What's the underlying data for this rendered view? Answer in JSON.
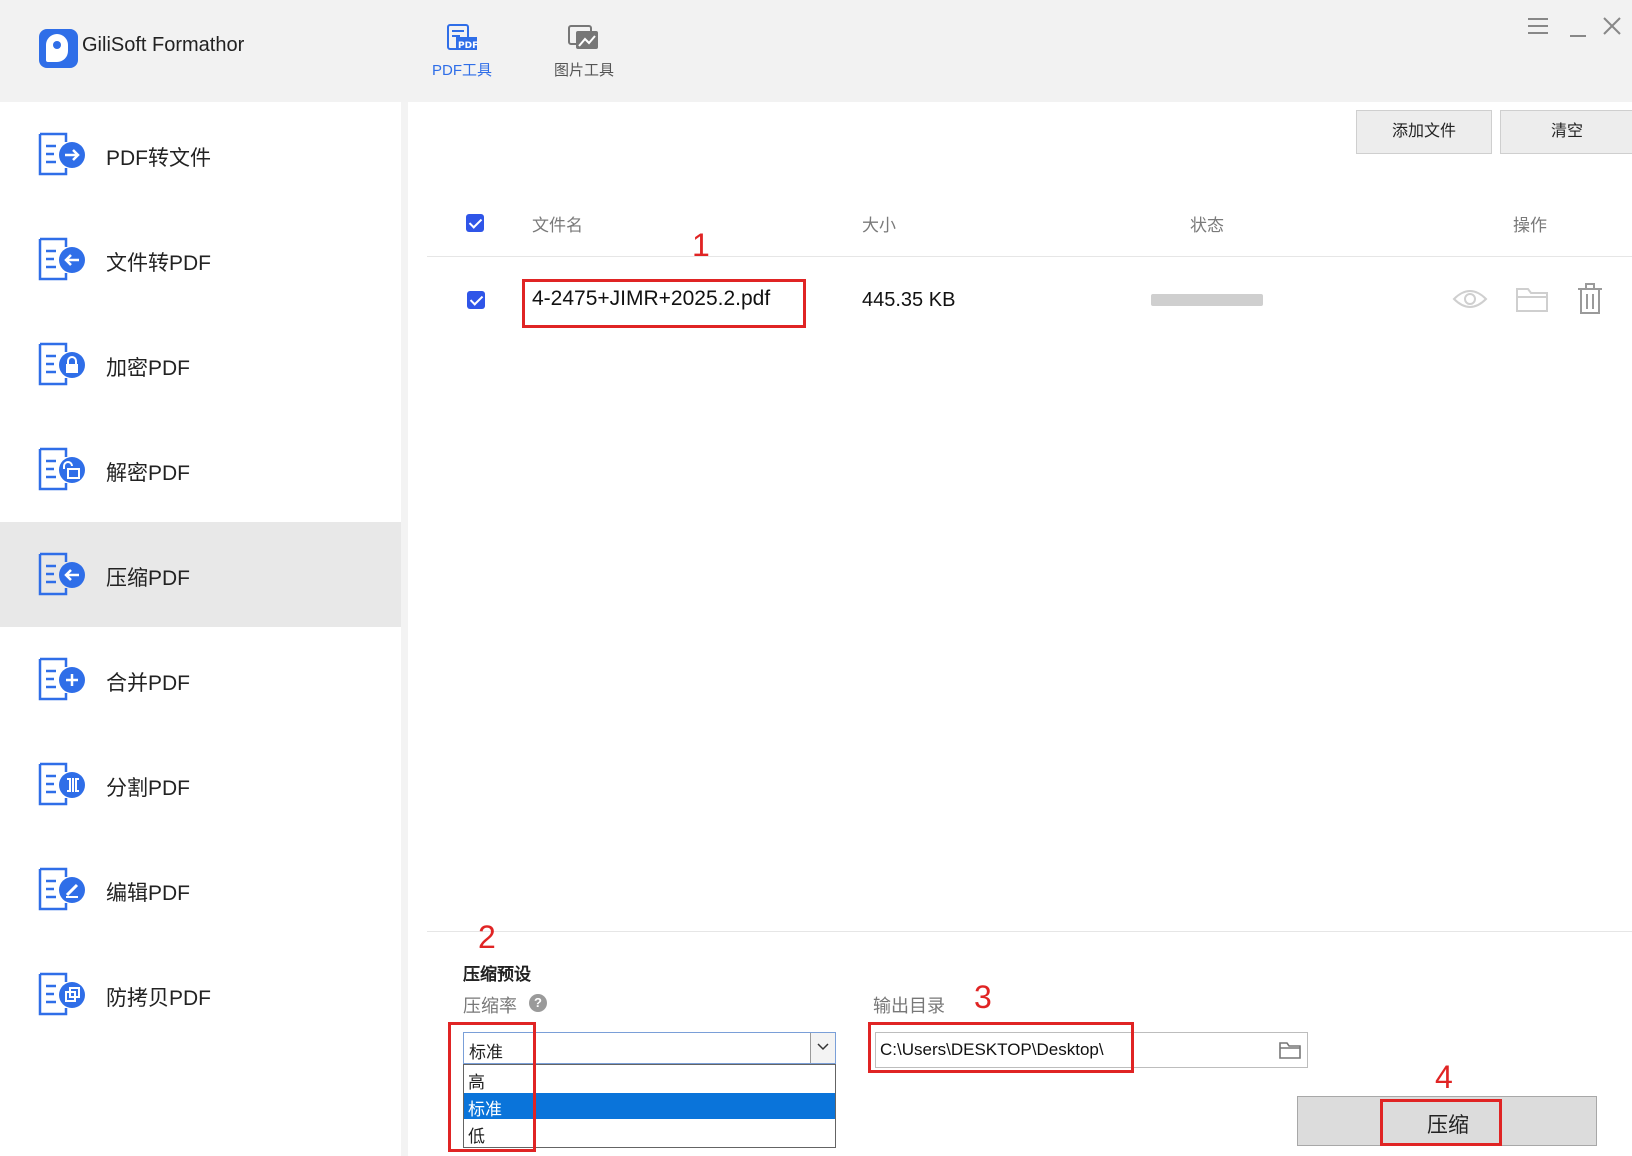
{
  "app": {
    "title": "GiliSoft Formathor"
  },
  "top_tabs": [
    {
      "label": "PDF工具",
      "active": true,
      "icon": "pdf-tool-icon"
    },
    {
      "label": "图片工具",
      "active": false,
      "icon": "image-tool-icon"
    }
  ],
  "window_controls": [
    "menu-icon",
    "minimize-icon",
    "close-icon"
  ],
  "sidebar": {
    "items": [
      {
        "label": "PDF转文件",
        "icon": "pdf-to-file-icon",
        "active": false
      },
      {
        "label": "文件转PDF",
        "icon": "file-to-pdf-icon",
        "active": false
      },
      {
        "label": "加密PDF",
        "icon": "encrypt-pdf-icon",
        "active": false
      },
      {
        "label": "解密PDF",
        "icon": "decrypt-pdf-icon",
        "active": false
      },
      {
        "label": "压缩PDF",
        "icon": "compress-pdf-icon",
        "active": true
      },
      {
        "label": "合并PDF",
        "icon": "merge-pdf-icon",
        "active": false
      },
      {
        "label": "分割PDF",
        "icon": "split-pdf-icon",
        "active": false
      },
      {
        "label": "编辑PDF",
        "icon": "edit-pdf-icon",
        "active": false
      },
      {
        "label": "防拷贝PDF",
        "icon": "copy-protect-pdf-icon",
        "active": false
      }
    ]
  },
  "toolbar": {
    "add_file_label": "添加文件",
    "clear_label": "清空"
  },
  "table": {
    "columns": [
      "文件名",
      "大小",
      "状态",
      "操作"
    ],
    "rows": [
      {
        "checked": true,
        "filename": "4-2475+JIMR+2025.2.pdf",
        "size": "445.35 KB",
        "status_progress": 0,
        "actions": [
          "eye-icon",
          "folder-icon",
          "trash-icon"
        ]
      }
    ]
  },
  "compress": {
    "preset_title": "压缩预设",
    "rate_label": "压缩率",
    "selected": "标准",
    "options": [
      "高",
      "标准",
      "低"
    ],
    "selected_index": 1,
    "output_label": "输出目录",
    "output_path": "C:\\Users\\DESKTOP\\Desktop\\",
    "compress_button": "压缩"
  },
  "annotations": {
    "n1": "1",
    "n2": "2",
    "n3": "3",
    "n4": "4"
  },
  "colors": {
    "accent": "#2f6ee8",
    "annotation_red": "#e02424",
    "selected_option": "#0a74da"
  }
}
